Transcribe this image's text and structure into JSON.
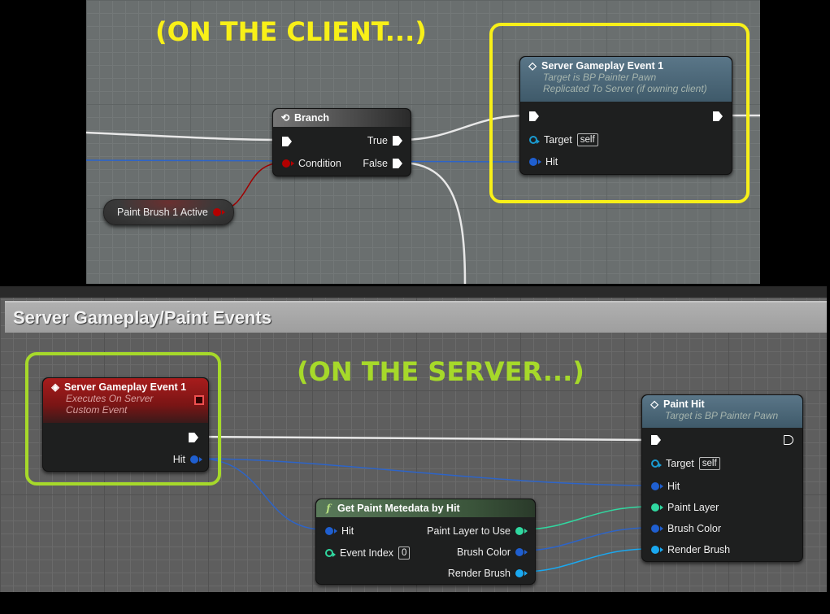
{
  "client_panel": {
    "annotation": "(ON THE CLIENT...)",
    "annotation_color": "#f8f018",
    "branch_node": {
      "title": "Branch",
      "icon": "branch-icon",
      "pins_in": [
        "Condition"
      ],
      "pins_out": [
        "True",
        "False"
      ]
    },
    "variable_node": {
      "label": "Paint Brush 1 Active",
      "pin_color": "#b40000"
    },
    "server_call_node": {
      "title": "Server Gameplay Event 1",
      "icon": "event-diamond-icon",
      "subtitle_1": "Target is BP Painter Pawn",
      "subtitle_2": "Replicated To Server (if owning client)",
      "target_label": "Target",
      "target_value": "self",
      "hit_label": "Hit"
    }
  },
  "server_panel": {
    "comment_title": "Server Gameplay/Paint Events",
    "annotation": "(ON THE SERVER...)",
    "annotation_color": "#a6d92a",
    "custom_event_node": {
      "title": "Server Gameplay Event 1",
      "icon": "custom-event-icon",
      "subtitle_1": "Executes On Server",
      "subtitle_2": "Custom Event",
      "hit_label": "Hit"
    },
    "metadata_node": {
      "title": "Get Paint Metedata by Hit",
      "icon": "function-icon",
      "in_hit": "Hit",
      "in_event_index": "Event Index",
      "event_index_value": "0",
      "out_paint_layer": "Paint Layer to Use",
      "out_brush_color": "Brush Color",
      "out_render_brush": "Render Brush"
    },
    "paint_hit_node": {
      "title": "Paint Hit",
      "icon": "event-diamond-icon",
      "subtitle": "Target is BP Painter Pawn",
      "target_label": "Target",
      "target_value": "self",
      "pins": [
        "Hit",
        "Paint Layer",
        "Brush Color",
        "Render Brush"
      ]
    }
  },
  "colors": {
    "struct_pin": "#1f5fd0",
    "teal_pin": "#30d8a0",
    "cyan_pin": "#1aa8f0",
    "bool_pin": "#b40000",
    "target_pin": "#1a9ad0"
  }
}
